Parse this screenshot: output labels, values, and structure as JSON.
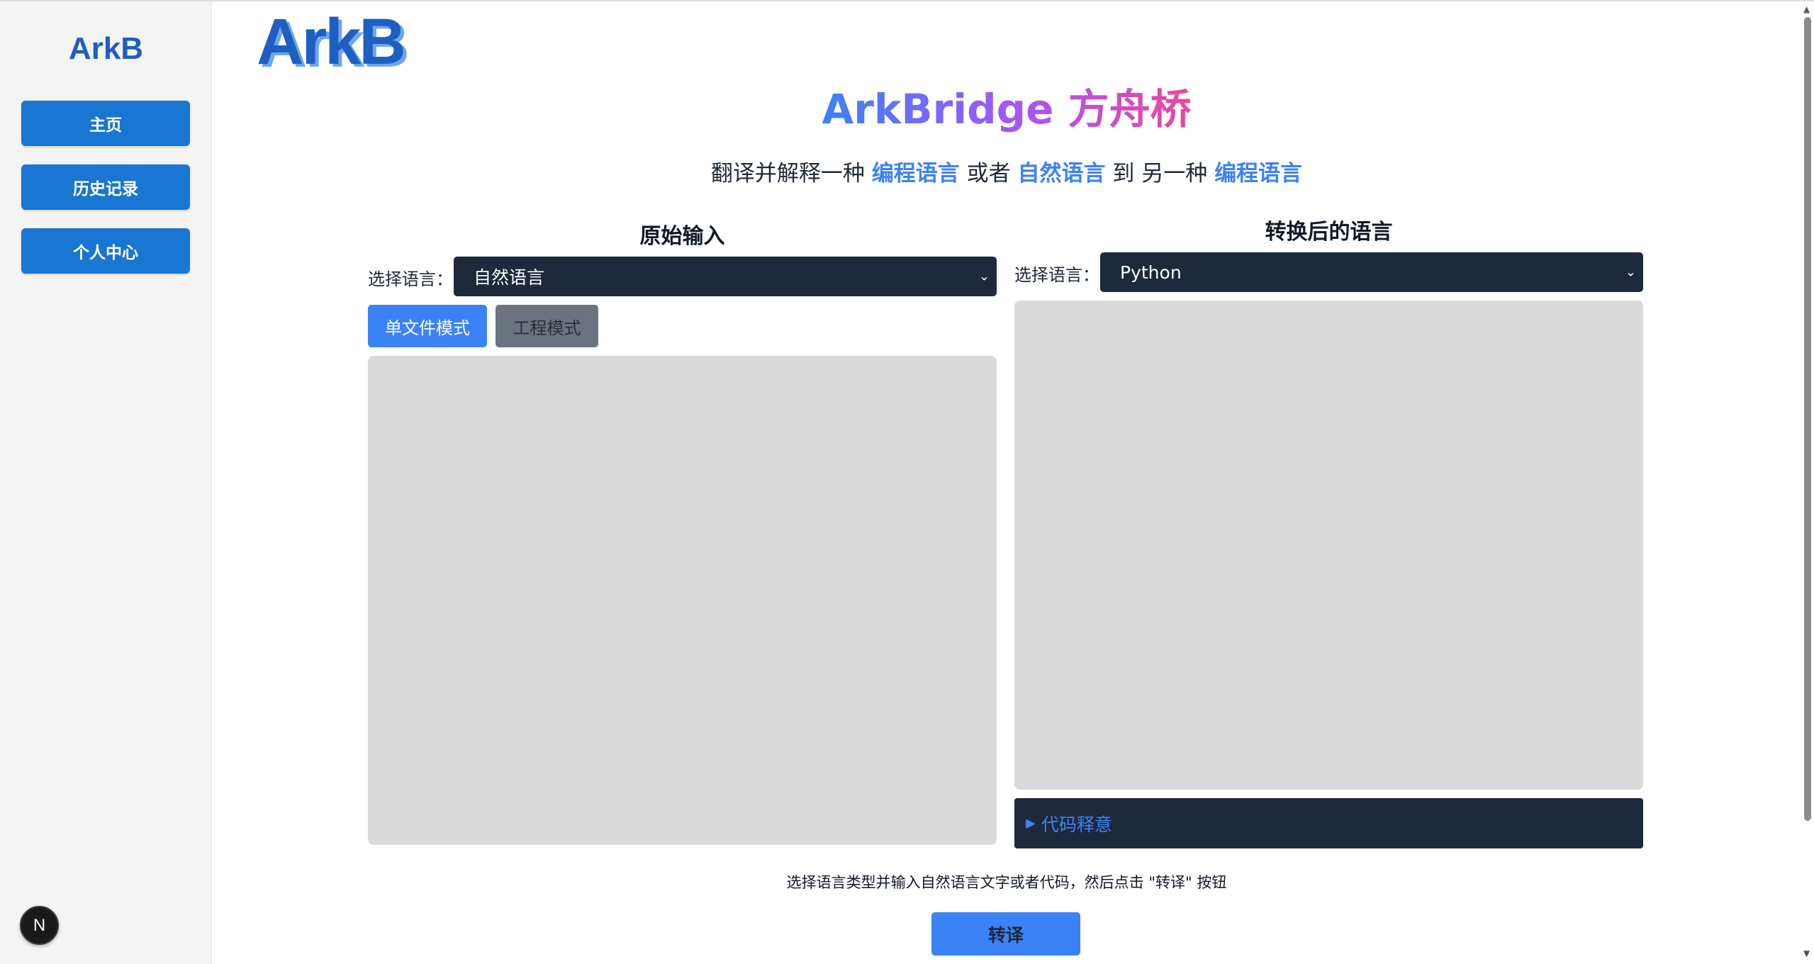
{
  "sidebar": {
    "logo": "ArkB",
    "items": [
      {
        "label": "主页"
      },
      {
        "label": "历史记录"
      },
      {
        "label": "个人中心"
      }
    ],
    "badge": "N"
  },
  "header": {
    "logo": "ArkB",
    "title": "ArkBridge 方舟桥",
    "subtitle": {
      "part1": "翻译并解释一种 ",
      "hl1": "编程语言",
      "part2": " 或者 ",
      "hl2": "自然语言",
      "part3": " 到 另一种 ",
      "hl3": "编程语言"
    }
  },
  "input_panel": {
    "title": "原始输入",
    "lang_label": "选择语言：",
    "selected_language": "自然语言",
    "modes": [
      "单文件模式",
      "工程模式"
    ],
    "active_mode": "单文件模式"
  },
  "output_panel": {
    "title": "转换后的语言",
    "lang_label": "选择语言：",
    "selected_language": "Python",
    "explain_label": "代码释意"
  },
  "footer": {
    "hint": "选择语言类型并输入自然语言文字或者代码，然后点击 \"转译\" 按钮",
    "translate_label": "转译"
  },
  "colors": {
    "accent": "#3b82f6",
    "nav": "#1976d2",
    "dark": "#1e293b",
    "logo": "#1d5fc2"
  }
}
